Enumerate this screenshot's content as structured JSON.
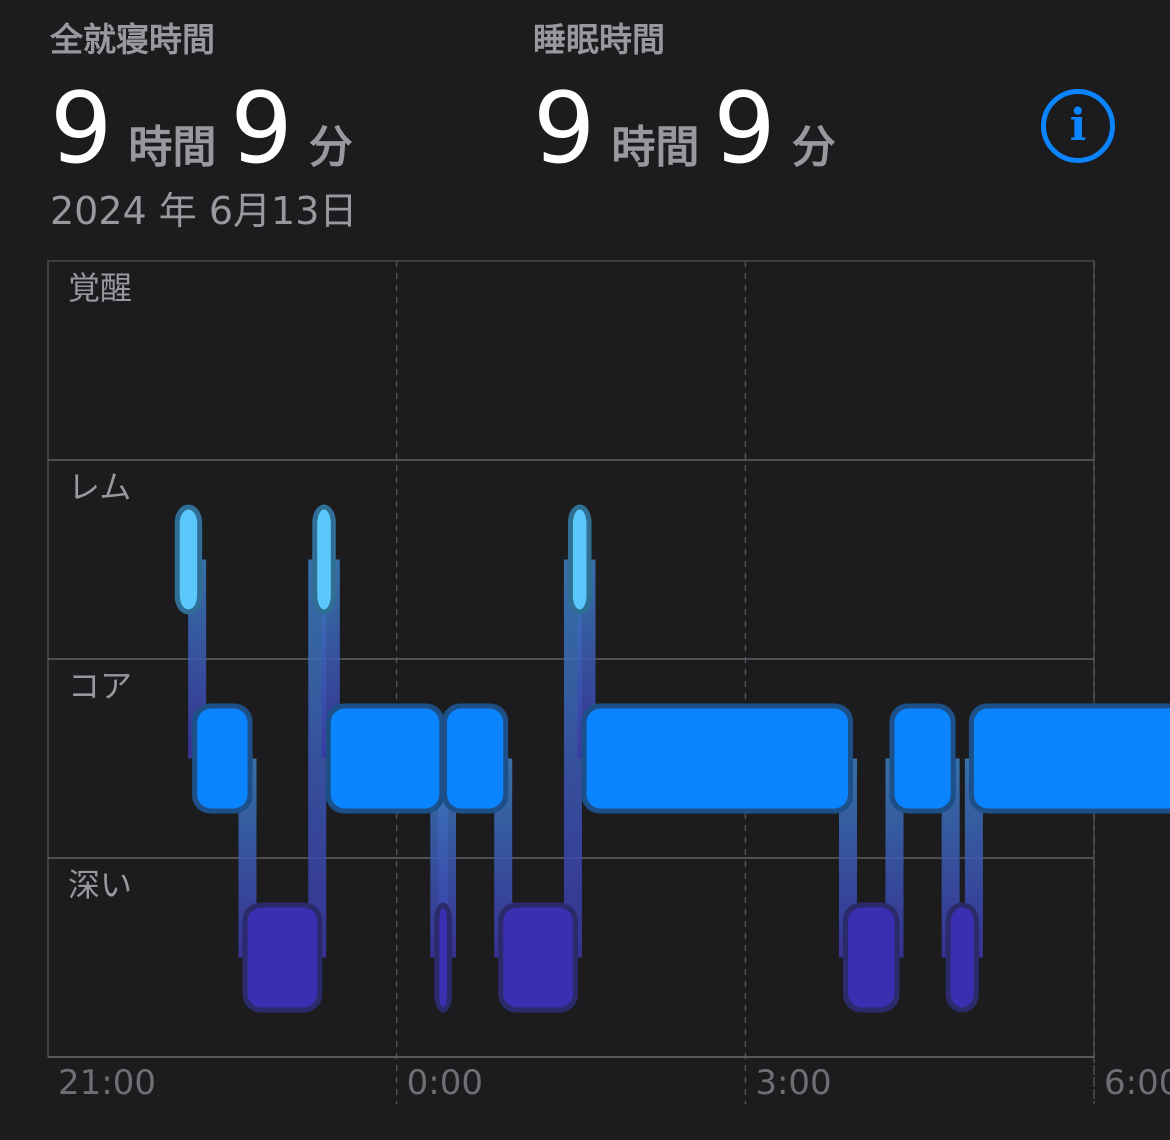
{
  "summary": {
    "time_in_bed": {
      "label": "全就寝時間",
      "hours": "9",
      "hours_unit": "時間",
      "minutes": "9",
      "minutes_unit": "分"
    },
    "time_asleep": {
      "label": "睡眠時間",
      "hours": "9",
      "hours_unit": "時間",
      "minutes": "9",
      "minutes_unit": "分"
    },
    "date": "2024 年 6月13日"
  },
  "info_icon": "info-circle-icon",
  "colors": {
    "background": "#1c1c1e",
    "rem": "#5ac8fa",
    "core": "#0a84ff",
    "deep": "#3a2fb0",
    "connector_top": "#3b7fbf",
    "connector_bottom": "#3b36a6",
    "text_secondary": "#98989d",
    "grid": "#8e8e93"
  },
  "chart_data": {
    "type": "sleep-stage-timeline",
    "stages": [
      "覚醒",
      "レム",
      "コア",
      "深い"
    ],
    "x_ticks": [
      "21:00",
      "0:00",
      "3:00",
      "6:00"
    ],
    "x_range_hours_since_21": [
      0,
      9
    ],
    "segments": [
      {
        "stage": "レム",
        "start": "22:08",
        "end": "22:17"
      },
      {
        "stage": "コア",
        "start": "22:17",
        "end": "22:43"
      },
      {
        "stage": "深い",
        "start": "22:43",
        "end": "23:19"
      },
      {
        "stage": "レム",
        "start": "23:19",
        "end": "23:26"
      },
      {
        "stage": "コア",
        "start": "23:26",
        "end": "0:22"
      },
      {
        "stage": "深い",
        "start": "0:22",
        "end": "0:26"
      },
      {
        "stage": "コア",
        "start": "0:26",
        "end": "0:55"
      },
      {
        "stage": "深い",
        "start": "0:55",
        "end": "1:31"
      },
      {
        "stage": "レム",
        "start": "1:31",
        "end": "1:38"
      },
      {
        "stage": "コア",
        "start": "1:38",
        "end": "3:53"
      },
      {
        "stage": "深い",
        "start": "3:53",
        "end": "4:17"
      },
      {
        "stage": "コア",
        "start": "4:17",
        "end": "4:46"
      },
      {
        "stage": "深い",
        "start": "4:46",
        "end": "4:58"
      },
      {
        "stage": "コア",
        "start": "4:58",
        "end": "6:50"
      }
    ]
  }
}
